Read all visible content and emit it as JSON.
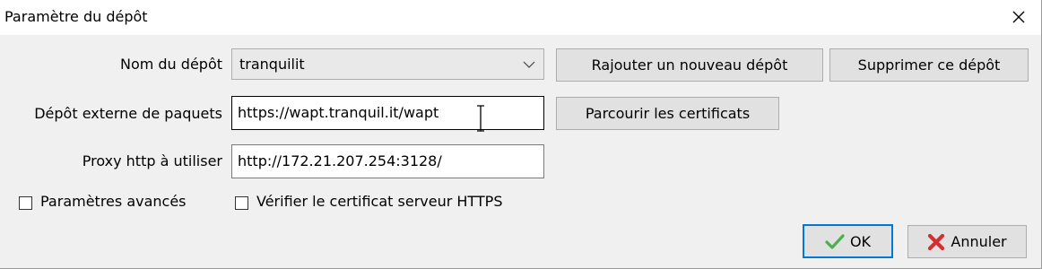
{
  "dialog": {
    "title": "Paramètre du dépôt",
    "close_symbol": "✕"
  },
  "labels": {
    "repo_name": "Nom du dépôt",
    "external_repo": "Dépôt externe de paquets",
    "proxy": "Proxy http à utiliser"
  },
  "repo_select": {
    "value": "tranquilit"
  },
  "external_repo_input": {
    "value": "https://wapt.tranquil.it/wapt"
  },
  "proxy_input": {
    "value": "http://172.21.207.254:3128/"
  },
  "buttons": {
    "add_repo": "Rajouter un nouveau dépôt",
    "delete_repo": "Supprimer ce dépôt",
    "browse_certs": "Parcourir les certificats",
    "ok": "OK",
    "cancel": "Annuler"
  },
  "checkboxes": {
    "advanced": {
      "label": "Paramètres avancés",
      "checked": false
    },
    "verify_https": {
      "label": "Vérifier le certificat serveur HTTPS",
      "checked": false
    }
  },
  "icons": {
    "ok": "checkmark-icon",
    "cancel": "red-x-icon",
    "close": "close-icon",
    "dropdown": "chevron-down-icon"
  },
  "colors": {
    "focus_blue": "#0078d7",
    "ok_green": "#4caf50",
    "cancel_red": "#d32f2f"
  }
}
